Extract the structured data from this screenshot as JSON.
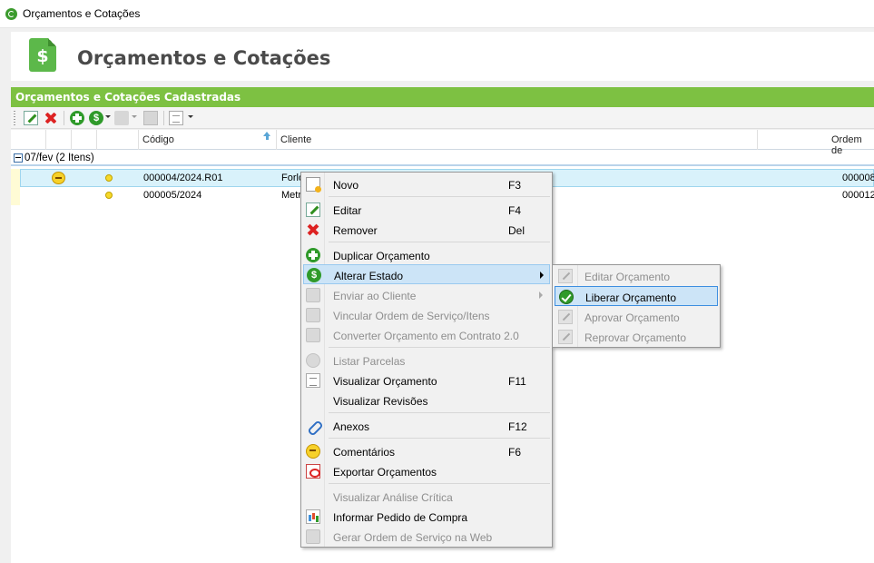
{
  "window": {
    "title": "Orçamentos e Cotações"
  },
  "header": {
    "page_title": "Orçamentos e Cotações"
  },
  "panel": {
    "title": "Orçamentos e Cotações Cadastradas"
  },
  "grid": {
    "columns": [
      "Código",
      "Cliente",
      "Ordem de"
    ],
    "group": {
      "label": "07/fev (2 Itens)"
    },
    "rows": [
      {
        "codigo": "000004/2024.R01",
        "cliente": "Forlo",
        "ordem": "000008",
        "selected": true,
        "comment": true
      },
      {
        "codigo": "000005/2024",
        "cliente": "Metr",
        "ordem": "000012",
        "selected": false,
        "comment": false
      }
    ]
  },
  "context_menu": {
    "items": [
      {
        "label": "Novo",
        "key": "F3",
        "icon": "new-icon",
        "disabled": false
      },
      {
        "label": "Editar",
        "key": "F4",
        "icon": "edit-icon",
        "disabled": false
      },
      {
        "label": "Remover",
        "key": "Del",
        "icon": "remove-icon",
        "disabled": false
      },
      {
        "label": "Duplicar Orçamento",
        "key": "",
        "icon": "duplicate-icon",
        "disabled": false
      },
      {
        "label": "Alterar Estado",
        "key": "",
        "icon": "state-icon",
        "disabled": false,
        "submenu": true,
        "hover": true
      },
      {
        "label": "Enviar ao Cliente",
        "key": "",
        "icon": "send-icon",
        "disabled": true,
        "submenu": true
      },
      {
        "label": "Vincular Ordem de Serviço/Itens",
        "key": "",
        "icon": "link-icon",
        "disabled": true
      },
      {
        "label": "Converter Orçamento em Contrato 2.0",
        "key": "",
        "icon": "convert-icon",
        "disabled": true
      },
      {
        "label": "Listar Parcelas",
        "key": "",
        "icon": "parcels-icon",
        "disabled": true
      },
      {
        "label": "Visualizar Orçamento",
        "key": "F11",
        "icon": "view-icon",
        "disabled": false
      },
      {
        "label": "Visualizar Revisões",
        "key": "",
        "icon": "",
        "disabled": false
      },
      {
        "label": "Anexos",
        "key": "F12",
        "icon": "attach-icon",
        "disabled": false
      },
      {
        "label": "Comentários",
        "key": "F6",
        "icon": "comment-icon",
        "disabled": false
      },
      {
        "label": "Exportar Orçamentos",
        "key": "",
        "icon": "pdf-icon",
        "disabled": false
      },
      {
        "label": "Visualizar Análise Crítica",
        "key": "",
        "icon": "",
        "disabled": true
      },
      {
        "label": "Informar Pedido de Compra",
        "key": "",
        "icon": "purchase-icon",
        "disabled": false
      },
      {
        "label": "Gerar Ordem de Serviço na Web",
        "key": "",
        "icon": "web-icon",
        "disabled": true
      }
    ]
  },
  "sub_menu": {
    "items": [
      {
        "label": "Editar Orçamento",
        "icon": "edit-icon",
        "disabled": true
      },
      {
        "label": "Liberar Orçamento",
        "icon": "check-icon",
        "disabled": false,
        "hover": true
      },
      {
        "label": "Aprovar Orçamento",
        "icon": "approve-icon",
        "disabled": true
      },
      {
        "label": "Reprovar Orçamento",
        "icon": "reject-icon",
        "disabled": true
      }
    ]
  },
  "colors": {
    "accent_green": "#7dc142",
    "title_text": "#4a4a4a",
    "menu_hover": "#cce4f7",
    "selected_row": "#d9f2fb"
  }
}
